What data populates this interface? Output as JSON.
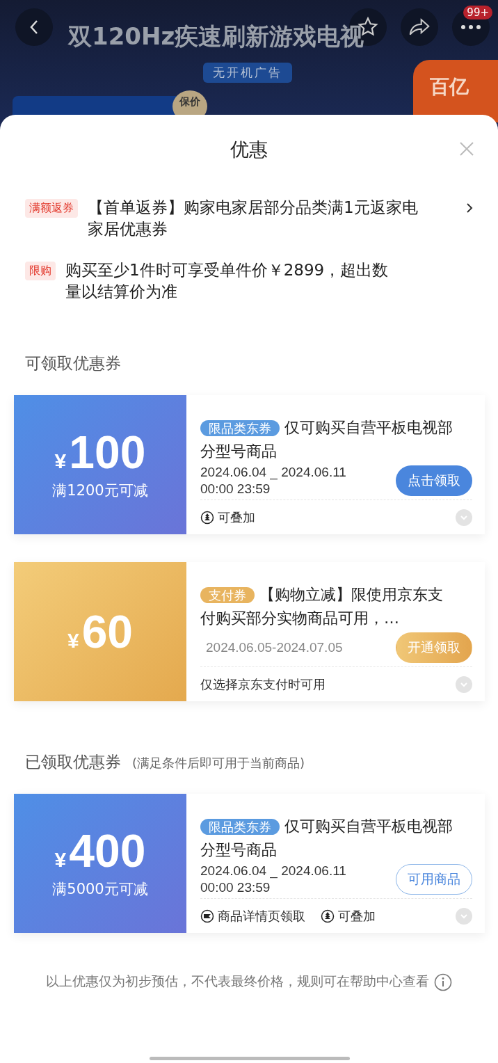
{
  "header": {
    "title": "双120Hz疾速刷新游戏电视",
    "badge": "无开机广告",
    "price_tag": "保价",
    "promo": "百亿",
    "notification_count": "99+"
  },
  "sheet": {
    "title": "优惠",
    "offers": [
      {
        "tag": "满额返券",
        "text": "【首单返券】购家电家居部分品类满1元返家电家居优惠券",
        "has_arrow": true
      },
      {
        "tag": "限购",
        "text": "购买至少1件时可享受单件价￥2899，超出数量以结算价为准",
        "has_arrow": false
      }
    ],
    "sections": [
      {
        "title": "可领取优惠券",
        "coupons": [
          {
            "kind": "blue",
            "currency": "¥",
            "amount": "100",
            "condition": "满1200元可减",
            "tag": "限品类东券",
            "description": "仅可购买自营平板电视部分型号商品",
            "validity": [
              "2024.06.04 _ 2024.06.11",
              "00:00 23:59"
            ],
            "button": {
              "label": "点击领取",
              "kind": "filled"
            },
            "footnotes": [
              {
                "kind": "stackable",
                "text": "可叠加"
              }
            ]
          },
          {
            "kind": "gold",
            "currency": "¥",
            "amount": "60",
            "tag": "支付券",
            "description": "【购物立减】限使用京东支付购买部分实物商品可用，…",
            "validity": [
              "2024.06.05-2024.07.05"
            ],
            "button": {
              "label": "开通领取",
              "kind": "filled"
            },
            "footnotes": [
              {
                "kind": "plain",
                "text": "仅选择京东支付时可用"
              }
            ]
          }
        ]
      },
      {
        "title": "已领取优惠券",
        "note": "(满足条件后即可用于当前商品)",
        "coupons": [
          {
            "kind": "blue",
            "currency": "¥",
            "amount": "400",
            "condition": "满5000元可减",
            "tag": "限品类东券",
            "description": "仅可购买自营平板电视部分型号商品",
            "validity": [
              "2024.06.04 _ 2024.06.11",
              "00:00 23:59"
            ],
            "button": {
              "label": "可用商品",
              "kind": "outline"
            },
            "footnotes": [
              {
                "kind": "claim",
                "text": "商品详情页领取"
              },
              {
                "kind": "stackable",
                "text": "可叠加"
              }
            ]
          }
        ]
      }
    ],
    "disclaimer": "以上优惠仅为初步预估，不代表最终价格，规则可在帮助中心查看"
  }
}
